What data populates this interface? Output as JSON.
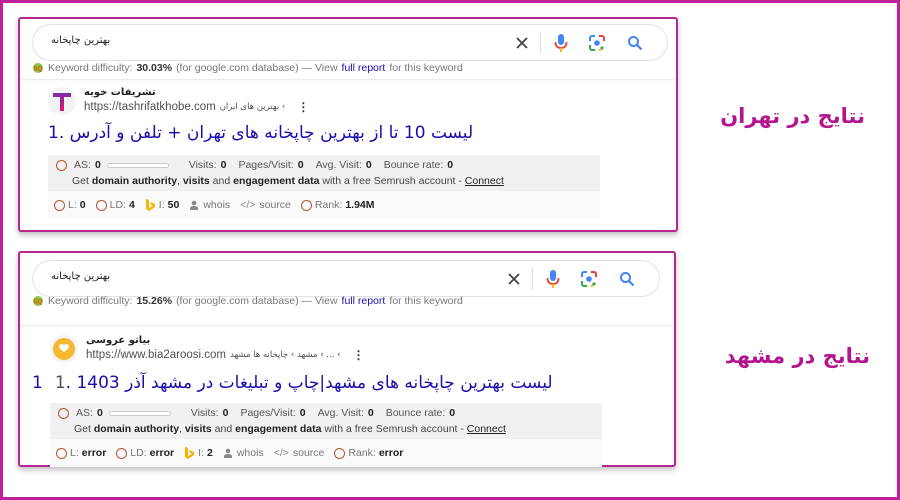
{
  "colors": {
    "frame": "#c0209a",
    "caption": "#b5148f",
    "link": "#1a0dab",
    "metric_circle": "#b8532f"
  },
  "panels": [
    {
      "caption": "نتایج در تهران",
      "search": {
        "query": "بهترین چاپخانه",
        "icons": [
          "clear-icon",
          "mic-icon",
          "lens-icon",
          "search-icon"
        ]
      },
      "keyword_difficulty": {
        "label": "Keyword difficulty:",
        "value": "30.03%",
        "db_text": "(for google.com database) — View",
        "link": "full report",
        "suffix": "for this keyword"
      },
      "result": {
        "favicon_letter": "T",
        "site_name": "تشریفات خوبه",
        "url": "https://tashrifatkhobe.com",
        "breadcrumb": "› بهترین های ایران",
        "rank_prefix": "",
        "title": "لیست 10 تا از بهترین چاپخانه های تهران + تلفن و آدرس .1"
      },
      "seo": {
        "as_label": "AS:",
        "as_value": "0",
        "visits_label": "Visits:",
        "visits_value": "0",
        "pages_label": "Pages/Visit:",
        "pages_value": "0",
        "avg_label": "Avg. Visit:",
        "avg_value": "0",
        "bounce_label": "Bounce rate:",
        "bounce_value": "0",
        "promo_pre": "Get",
        "promo_b1": "domain authority",
        "promo_mid1": ",",
        "promo_b2": "visits",
        "promo_mid2": "and",
        "promo_b3": "engagement data",
        "promo_post": "with a free Semrush account -",
        "connect": "Connect"
      },
      "links_bar": {
        "l_label": "L:",
        "l_value": "0",
        "ld_label": "LD:",
        "ld_value": "4",
        "i_label": "I:",
        "i_value": "50",
        "whois": "whois",
        "source": "source",
        "rank_label": "Rank:",
        "rank_value": "1.94M"
      }
    },
    {
      "caption": "نتایج در مشهد",
      "search": {
        "query": "بهترین چاپخانه",
        "icons": [
          "clear-icon",
          "mic-icon",
          "lens-icon",
          "search-icon"
        ]
      },
      "keyword_difficulty": {
        "label": "Keyword difficulty:",
        "value": "15.26%",
        "db_text": "(for google.com database) — View",
        "link": "full report",
        "suffix": "for this keyword"
      },
      "result": {
        "favicon_letter": "",
        "site_name": "بیاتو عروسی",
        "url": "https://www.bia2aroosi.com",
        "breadcrumb": "› ... › مشهد › چاپخانه ها مشهد",
        "rank_prefix": "1",
        "title": "لیست بهترین چاپخانه های مشهد|چاپ و تبلیغات در مشهد آذر 1403 .1"
      },
      "seo": {
        "as_label": "AS:",
        "as_value": "0",
        "visits_label": "Visits:",
        "visits_value": "0",
        "pages_label": "Pages/Visit:",
        "pages_value": "0",
        "avg_label": "Avg. Visit:",
        "avg_value": "0",
        "bounce_label": "Bounce rate:",
        "bounce_value": "0",
        "promo_pre": "Get",
        "promo_b1": "domain authority",
        "promo_mid1": ",",
        "promo_b2": "visits",
        "promo_mid2": "and",
        "promo_b3": "engagement data",
        "promo_post": "with a free Semrush account -",
        "connect": "Connect"
      },
      "links_bar": {
        "l_label": "L:",
        "l_value": "error",
        "ld_label": "LD:",
        "ld_value": "error",
        "i_label": "I:",
        "i_value": "2",
        "whois": "whois",
        "source": "source",
        "rank_label": "Rank:",
        "rank_value": "error"
      }
    }
  ]
}
